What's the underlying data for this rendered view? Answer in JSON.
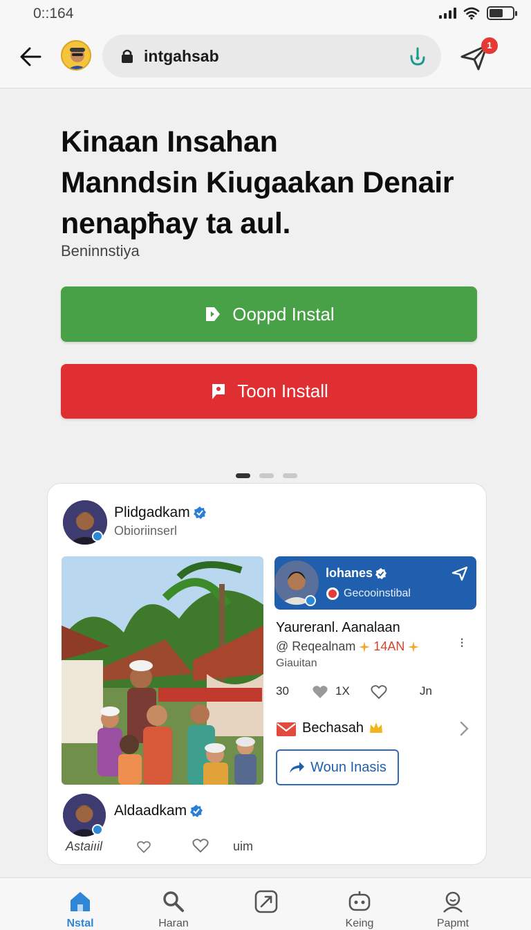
{
  "status_bar": {
    "time": "0::164",
    "battery_level": 0.6
  },
  "browser": {
    "url": "intgahsab",
    "notification_count": "1"
  },
  "hero": {
    "headline": [
      "Kinaan Insahan",
      "Manndsin Kiugaakan Denair",
      "nenapħay ta aul."
    ],
    "subline": "Beninnstiya",
    "primary_button": "Oopрd Instal",
    "secondary_button": "Toon Install",
    "carousel": {
      "pages": 3,
      "active": 1
    }
  },
  "post": {
    "author": "Plidgadkam",
    "author_sub": "Obioriinserl",
    "card": {
      "name": "lohanes",
      "sub": "Gecooinstibal"
    },
    "title": "Yaureranl. Aanalaan",
    "meta_handle": "@ Reqealnam",
    "meta_highlight": "14AN",
    "meta_sub": "Giauitan",
    "stats": {
      "count": "30",
      "likes": "1X",
      "extra": "Jn"
    },
    "inbox_label": "Bechasah",
    "outline_button": "Woun Inasis",
    "author2": "Aldaadkam",
    "actions_label": "Astaiıil",
    "actions_extra": "uim"
  },
  "tabs": [
    {
      "label": "Nstal",
      "icon": "home-icon",
      "active": true
    },
    {
      "label": "Haran",
      "icon": "search-icon",
      "active": false
    },
    {
      "label": "",
      "icon": "compose-icon",
      "active": false
    },
    {
      "label": "Keing",
      "icon": "bot-icon",
      "active": false
    },
    {
      "label": "Papmt",
      "icon": "profile-icon",
      "active": false
    }
  ],
  "colors": {
    "green": "#48a047",
    "red": "#e02f32",
    "accent_blue": "#2f86d6",
    "card_blue": "#1f5fad"
  }
}
